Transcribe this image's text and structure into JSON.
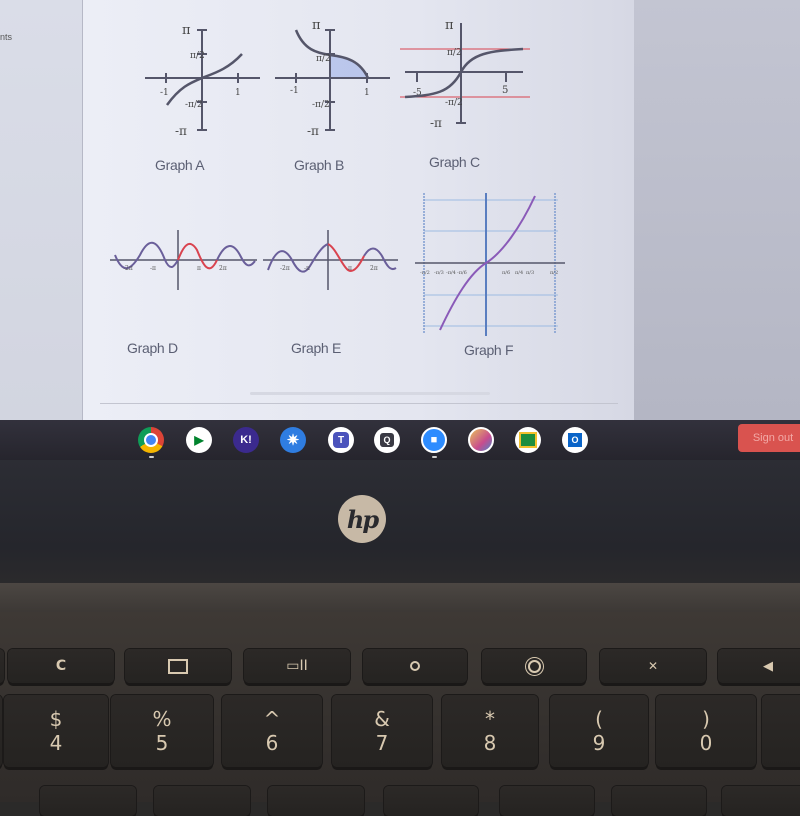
{
  "left_pane": {
    "truncated_text": "nts"
  },
  "graphs": [
    {
      "id": "A",
      "label": "Graph A",
      "y_ticks": [
        "π",
        "π/2",
        "-π/2",
        "-π"
      ],
      "x_ticks": [
        "-1",
        "1"
      ]
    },
    {
      "id": "B",
      "label": "Graph B",
      "y_ticks": [
        "π",
        "π/2",
        "-π/2",
        "-π"
      ],
      "x_ticks": [
        "-1",
        "1"
      ]
    },
    {
      "id": "C",
      "label": "Graph C",
      "y_ticks": [
        "π",
        "π/2",
        "-π/2",
        "-π"
      ],
      "x_ticks": [
        "-5",
        "5"
      ]
    },
    {
      "id": "D",
      "label": "Graph D",
      "x_ticks": [
        "-2π",
        "-π",
        "π",
        "2π"
      ]
    },
    {
      "id": "E",
      "label": "Graph E",
      "x_ticks": [
        "-2π",
        "-π",
        "π",
        "2π"
      ]
    },
    {
      "id": "F",
      "label": "Graph F",
      "x_ticks": [
        "-π/2",
        "-π/3",
        "-π/4",
        "-π/6",
        "π/6",
        "π/4",
        "π/3",
        "π/2"
      ]
    }
  ],
  "colors": {
    "curve": "#6a5f9a",
    "highlight": "#d9434f",
    "shade": "#8fa6e6",
    "signout": "#d9534f"
  },
  "shelf": {
    "apps": [
      {
        "name": "chrome",
        "glyph": ""
      },
      {
        "name": "google-meet",
        "glyph": ""
      },
      {
        "name": "kahoot",
        "glyph": "K!"
      },
      {
        "name": "starburst-app",
        "glyph": "✷"
      },
      {
        "name": "microsoft-teams",
        "glyph": "T"
      },
      {
        "name": "quizlet",
        "glyph": "Q"
      },
      {
        "name": "zoom",
        "glyph": "■"
      },
      {
        "name": "photo-app",
        "glyph": ""
      },
      {
        "name": "google-classroom",
        "glyph": "▣"
      },
      {
        "name": "outlook",
        "glyph": "O"
      }
    ],
    "signout_label": "Sign out"
  },
  "laptop": {
    "logo": "hp"
  },
  "keyboard": {
    "fn_row": [
      {
        "name": "refresh",
        "glyph": "C"
      },
      {
        "name": "fullscreen",
        "glyph": "⛶"
      },
      {
        "name": "overview",
        "glyph": "▭II"
      },
      {
        "name": "brightness-down",
        "glyph": "☼"
      },
      {
        "name": "brightness-up",
        "glyph": "✹"
      },
      {
        "name": "mute",
        "glyph": "🔇"
      },
      {
        "name": "volume-down",
        "glyph": "🔉"
      }
    ],
    "num_row": [
      {
        "top": "$",
        "bottom": "4"
      },
      {
        "top": "%",
        "bottom": "5"
      },
      {
        "top": "^",
        "bottom": "6"
      },
      {
        "top": "&",
        "bottom": "7"
      },
      {
        "top": "*",
        "bottom": "8"
      },
      {
        "top": "(",
        "bottom": "9"
      },
      {
        "top": ")",
        "bottom": "0"
      }
    ]
  }
}
